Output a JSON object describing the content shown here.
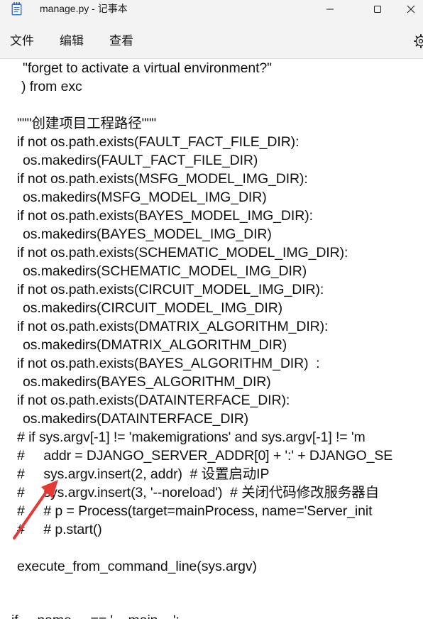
{
  "window": {
    "title": "manage.py - 记事本",
    "app_icon": "notepad-icon",
    "controls": [
      "minimize-icon",
      "maximize-icon",
      "close-icon"
    ]
  },
  "menu": {
    "items": [
      "文件",
      "编辑",
      "查看"
    ],
    "settings_icon": "gear-icon"
  },
  "editor": {
    "lines": [
      "        \"forget to activate a virtual environment?\"",
      "      ) from exc",
      "",
      "    \"\"\"创建项目工程路径\"\"\"",
      "    if not os.path.exists(FAULT_FACT_FILE_DIR):",
      "        os.makedirs(FAULT_FACT_FILE_DIR)",
      "    if not os.path.exists(MSFG_MODEL_IMG_DIR):",
      "        os.makedirs(MSFG_MODEL_IMG_DIR)",
      "    if not os.path.exists(BAYES_MODEL_IMG_DIR):",
      "        os.makedirs(BAYES_MODEL_IMG_DIR)",
      "    if not os.path.exists(SCHEMATIC_MODEL_IMG_DIR):",
      "        os.makedirs(SCHEMATIC_MODEL_IMG_DIR)",
      "    if not os.path.exists(CIRCUIT_MODEL_IMG_DIR):",
      "        os.makedirs(CIRCUIT_MODEL_IMG_DIR)",
      "    if not os.path.exists(DMATRIX_ALGORITHM_DIR):",
      "        os.makedirs(DMATRIX_ALGORITHM_DIR)",
      "    if not os.path.exists(BAYES_ALGORITHM_DIR)  :",
      "        os.makedirs(BAYES_ALGORITHM_DIR)",
      "    if not os.path.exists(DATAINTERFACE_DIR):",
      "        os.makedirs(DATAINTERFACE_DIR)",
      "    # if sys.argv[-1] != 'makemigrations' and sys.argv[-1] != 'm",
      "    #     addr = DJANGO_SERVER_ADDR[0] + ':' + DJANGO_SE",
      "    #     sys.argv.insert(2, addr)  # 设置启动IP",
      "    #     sys.argv.insert(3, '--noreload')  # 关闭代码修改服务器自",
      "    #     # p = Process(target=mainProcess, name='Server_init",
      "    #     # p.start()",
      "",
      "    execute_from_command_line(sys.argv)",
      "",
      "",
      "if __name__ == '__main__':"
    ]
  },
  "annotation": {
    "arrow_color": "#e53935"
  }
}
